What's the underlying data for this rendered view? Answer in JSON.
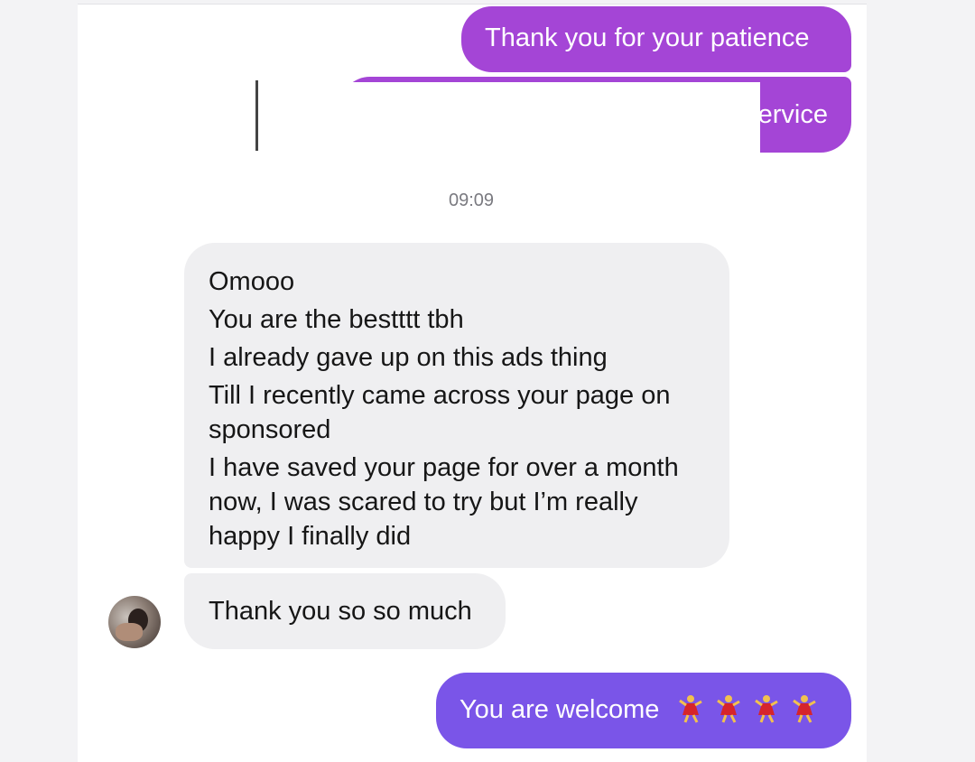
{
  "messages": [
    {
      "text": "Thank you for your patience"
    },
    {
      "text": "ervice"
    },
    {
      "time": "09:09"
    },
    {
      "lines": [
        "Omooo",
        "You are the bestttt tbh",
        "I already gave up on this ads thing",
        "Till I recently came across your page on",
        "sponsored",
        "I have saved your page for over a month",
        "now, I was scared to try but I’m really",
        "happy I finally did"
      ]
    },
    {
      "text": "Thank you so so much"
    },
    {
      "text": "You are welcome",
      "emoji": "dancer-icon",
      "emoji_count": 4
    }
  ],
  "colors": {
    "outgoing_purple": "#a445d6",
    "outgoing_violet": "#7a55e8",
    "incoming_bubble": "#efeff1"
  }
}
